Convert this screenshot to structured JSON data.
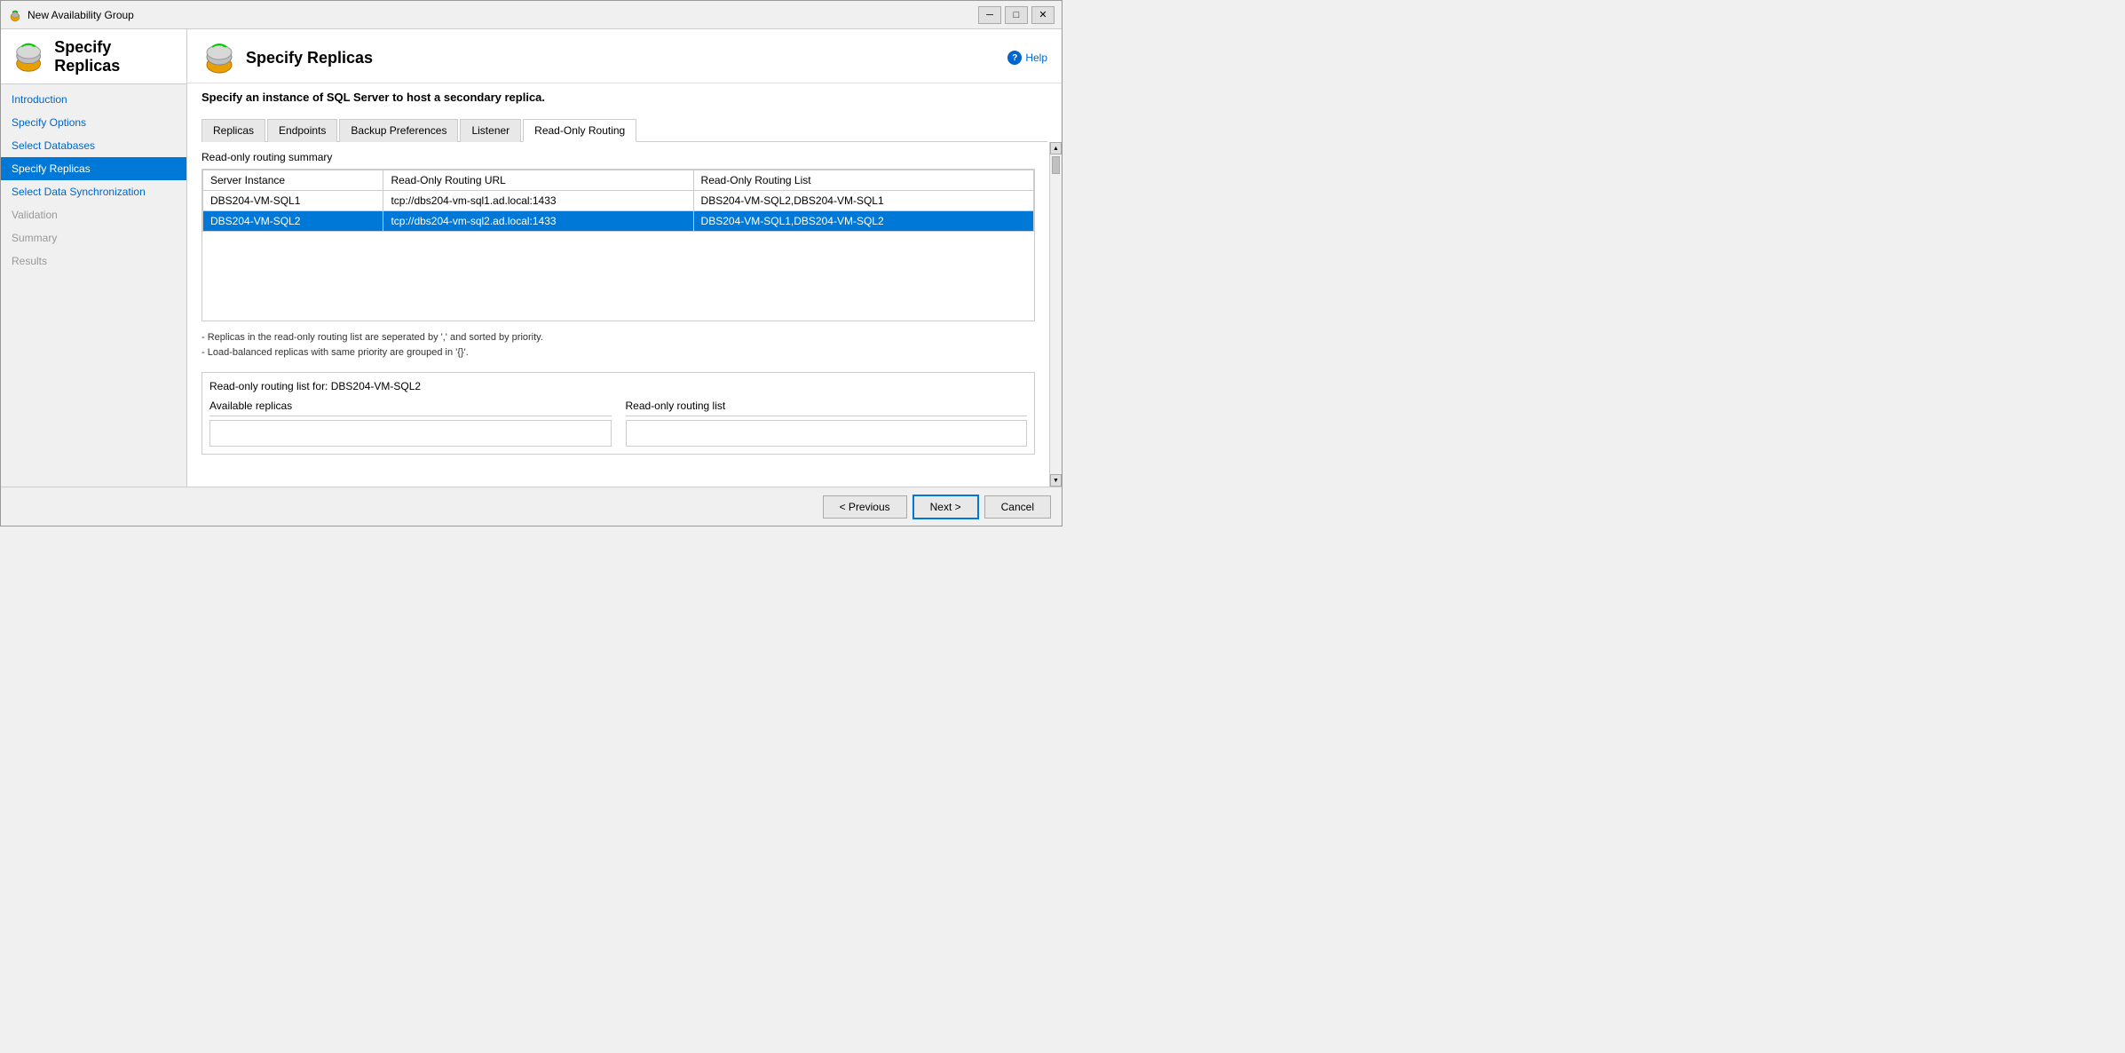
{
  "window": {
    "title": "New Availability Group",
    "minimize_label": "─",
    "maximize_label": "□",
    "close_label": "✕"
  },
  "header": {
    "title": "Specify Replicas",
    "subtitle": "Specify an instance of SQL Server to host a secondary replica."
  },
  "help": {
    "label": "Help"
  },
  "nav": {
    "items": [
      {
        "id": "introduction",
        "label": "Introduction",
        "state": "link"
      },
      {
        "id": "specify-options",
        "label": "Specify Options",
        "state": "link"
      },
      {
        "id": "select-databases",
        "label": "Select Databases",
        "state": "link"
      },
      {
        "id": "specify-replicas",
        "label": "Specify Replicas",
        "state": "active"
      },
      {
        "id": "select-data-sync",
        "label": "Select Data Synchronization",
        "state": "link"
      },
      {
        "id": "validation",
        "label": "Validation",
        "state": "link"
      },
      {
        "id": "summary",
        "label": "Summary",
        "state": "link"
      },
      {
        "id": "results",
        "label": "Results",
        "state": "link"
      }
    ]
  },
  "tabs": [
    {
      "id": "replicas",
      "label": "Replicas"
    },
    {
      "id": "endpoints",
      "label": "Endpoints"
    },
    {
      "id": "backup-preferences",
      "label": "Backup Preferences"
    },
    {
      "id": "listener",
      "label": "Listener"
    },
    {
      "id": "read-only-routing",
      "label": "Read-Only Routing",
      "active": true
    }
  ],
  "routing": {
    "summary_label": "Read-only routing summary",
    "table": {
      "columns": [
        "Server Instance",
        "Read-Only Routing URL",
        "Read-Only Routing List"
      ],
      "rows": [
        {
          "server_instance": "DBS204-VM-SQL1",
          "routing_url": "tcp://dbs204-vm-sql1.ad.local:1433",
          "routing_list": "DBS204-VM-SQL2,DBS204-VM-SQL1",
          "selected": false
        },
        {
          "server_instance": "DBS204-VM-SQL2",
          "routing_url": "tcp://dbs204-vm-sql2.ad.local:1433",
          "routing_list": "DBS204-VM-SQL1,DBS204-VM-SQL2",
          "selected": true
        }
      ]
    },
    "notes": [
      "- Replicas in the read-only routing list are seperated by ',' and sorted by priority.",
      "- Load-balanced replicas with same priority are grouped in '{}'."
    ],
    "routing_list_label": "Read-only routing list for: DBS204-VM-SQL2",
    "available_replicas_header": "Available replicas",
    "routing_list_header": "Read-only routing list"
  },
  "buttons": {
    "previous": "< Previous",
    "next": "Next >",
    "cancel": "Cancel"
  }
}
